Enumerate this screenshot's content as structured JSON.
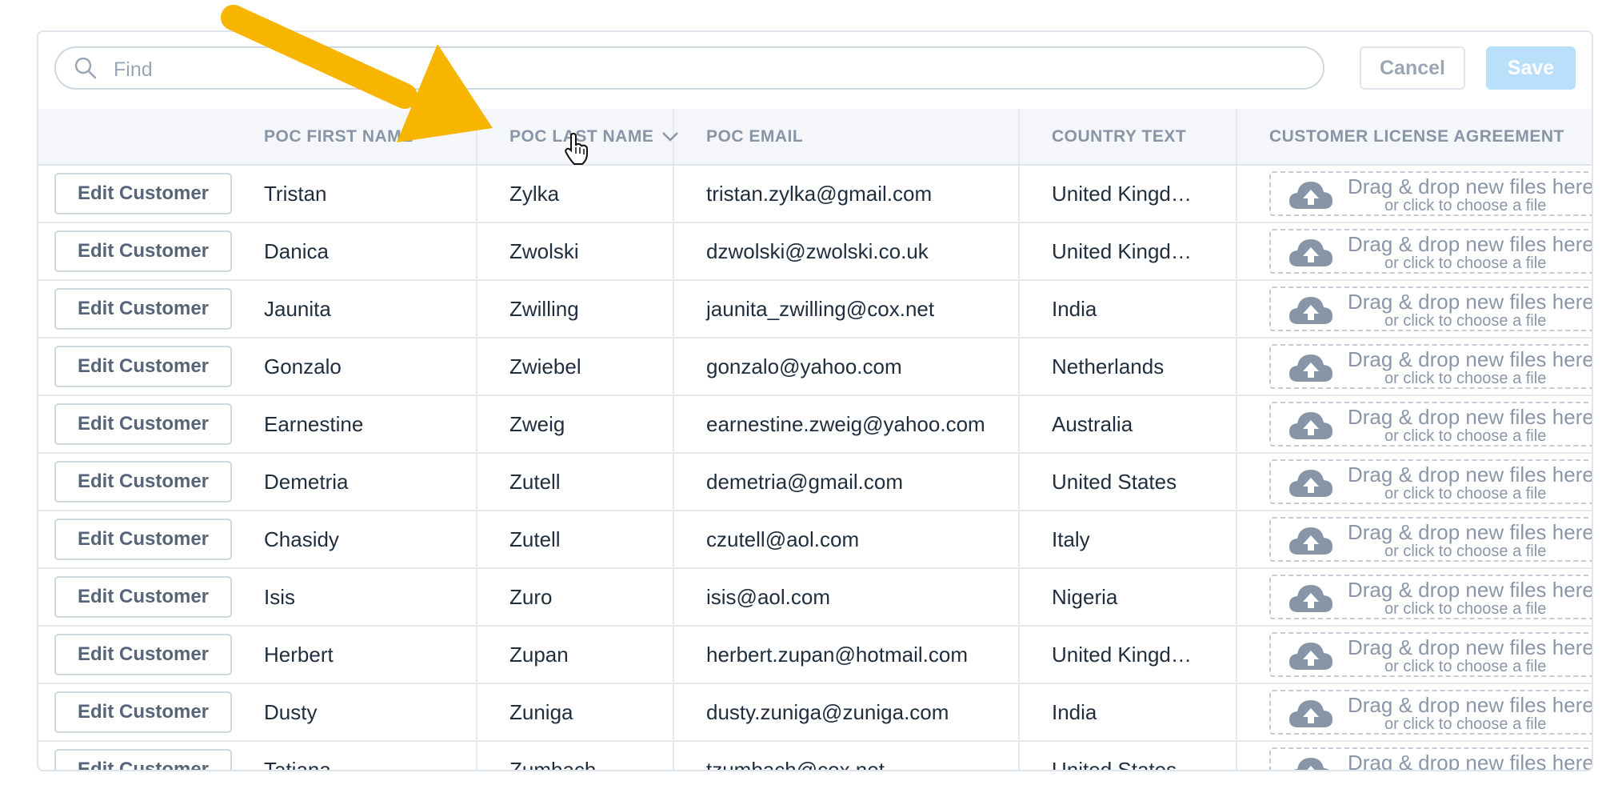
{
  "toolbar": {
    "search_placeholder": "Find",
    "search_value": "",
    "cancel_label": "Cancel",
    "save_label": "Save"
  },
  "columns": [
    "",
    "POC FIRST NAME",
    "POC LAST NAME",
    "POC EMAIL",
    "COUNTRY TEXT",
    "CUSTOMER LICENSE AGREEMENT"
  ],
  "sorted_column": "POC LAST NAME",
  "sort_direction": "descending",
  "row_action_label": "Edit Customer",
  "dropzone": {
    "main": "Drag & drop new files here",
    "sub": "or click to choose a file"
  },
  "rows": [
    {
      "first": "Tristan",
      "last": "Zylka",
      "email": "tristan.zylka@gmail.com",
      "country": "United Kingd…"
    },
    {
      "first": "Danica",
      "last": "Zwolski",
      "email": "dzwolski@zwolski.co.uk",
      "country": "United Kingd…"
    },
    {
      "first": "Jaunita",
      "last": "Zwilling",
      "email": "jaunita_zwilling@cox.net",
      "country": "India"
    },
    {
      "first": "Gonzalo",
      "last": "Zwiebel",
      "email": "gonzalo@yahoo.com",
      "country": "Netherlands"
    },
    {
      "first": "Earnestine",
      "last": "Zweig",
      "email": "earnestine.zweig@yahoo.com",
      "country": "Australia"
    },
    {
      "first": "Demetria",
      "last": "Zutell",
      "email": "demetria@gmail.com",
      "country": "United States"
    },
    {
      "first": "Chasidy",
      "last": "Zutell",
      "email": "czutell@aol.com",
      "country": "Italy"
    },
    {
      "first": "Isis",
      "last": "Zuro",
      "email": "isis@aol.com",
      "country": "Nigeria"
    },
    {
      "first": "Herbert",
      "last": "Zupan",
      "email": "herbert.zupan@hotmail.com",
      "country": "United Kingd…"
    },
    {
      "first": "Dusty",
      "last": "Zuniga",
      "email": "dusty.zuniga@zuniga.com",
      "country": "India"
    },
    {
      "first": "Tatiana",
      "last": "Zumbach",
      "email": "tzumbach@cox.net",
      "country": "United States"
    }
  ],
  "colors": {
    "accent_arrow": "#f7b500",
    "save_disabled": "#b8e0fb",
    "header_bg": "#f4f6f9",
    "border": "#dfe5ec"
  },
  "icons": [
    "search-icon",
    "chevron-down-icon",
    "cloud-upload-icon",
    "hand-pointer-cursor-icon",
    "arrow-annotation-icon"
  ]
}
